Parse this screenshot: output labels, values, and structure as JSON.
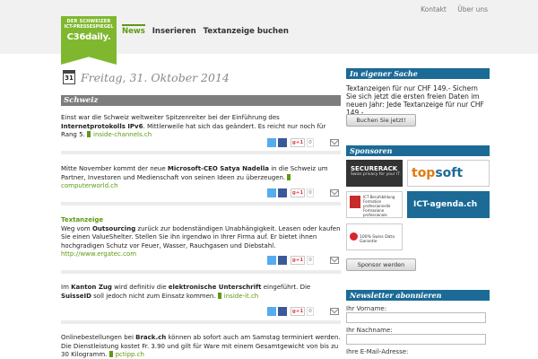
{
  "top_links": [
    "Kontakt",
    "Über uns"
  ],
  "logo": {
    "line1": "DER SCHWEIZER",
    "line2": "ICT-PRESSESPIEGEL",
    "line3": "C36daily."
  },
  "nav": [
    "News",
    "Inserieren",
    "Textanzeige buchen"
  ],
  "date": {
    "day": "31",
    "text": "Freitag, 31. Oktober 2014"
  },
  "section": "Schweiz",
  "share": {
    "gplus": "g+1",
    "count": "0"
  },
  "posts": [
    {
      "t1": "Einst war die Schweiz weltweiter Spitzenreiter bei der Einführung des ",
      "b1": "Internetprotokolls IPv6",
      "t2": ". Mittlerweile hat sich das geändert. Es reicht nur noch für Rang 5.",
      "link": "inside-channels.ch"
    },
    {
      "t1": "Mitte November kommt der neue ",
      "b1": "Microsoft-CEO Satya Nadella",
      "t2": " in die Schweiz um Partner, Investoren und Medienschaft von seinen Ideen zu überzeugen.",
      "link": "computerworld.ch"
    },
    {
      "label": "Textanzeige",
      "t1": "Weg vom ",
      "b1": "Outsourcing",
      "t2": " zurück zur bodenständigen Unabhängigkeit. Leasen oder kaufen Sie einen ValueShelter. Stellen Sie ihn irgendwo in Ihrer Firma auf. Er bietet ihnen hochgradigen Schutz vor Feuer, Wasser, Rauchgasen und Diebstahl.",
      "url": "http://www.ergatec.com"
    },
    {
      "t1": "Im ",
      "b1": "Kanton Zug",
      "t2": " wird definitiv die ",
      "b2": "elektronische Unterschrift",
      "t3": " eingeführt. Die ",
      "b3": "SuisseID",
      "t4": " soll jedoch nicht zum Einsatz kommen.",
      "link": "inside-it.ch"
    },
    {
      "t1": "Onlinebestellungen bei ",
      "b1": "Brack.ch",
      "t2": " können ab sofort auch am Samstag terminiert werden. Die Dienstleistung kostet Fr. 3.90 und gilt für Ware mit einem Gesamtgewicht von bis zu 30 Kilogramm.",
      "link": "pctipp.ch"
    }
  ],
  "sidebar": {
    "eigener_head": "In eigener Sache",
    "promo_label": "Textanzeigen für nur CHF 149.-",
    "promo_text": "Sichern Sie sich jetzt die ersten freien Daten im neuen Jahr: Jede Textanzeige für nur CHF 149.-",
    "promo_button": "Buchen Sie jetzt!",
    "sponsoren_head": "Sponsoren",
    "sponsors": {
      "securerack_a": "SECURERACK",
      "securerack_b": "Swiss privacy for your IT.",
      "topsoft_1": "top",
      "topsoft_2": "soft",
      "ict_text": "ICT Berufsbildung Formation professionnelle Formazione professionale",
      "agenda": "ICT-agenda.ch",
      "swissdata": "100% Swiss Data Garantie"
    },
    "sponsor_button": "Sponsor werden",
    "newsletter_head": "Newsletter abonnieren",
    "fields": [
      "Ihr Vorname:",
      "Ihr Nachname:",
      "Ihre E-Mail-Adresse:"
    ]
  }
}
